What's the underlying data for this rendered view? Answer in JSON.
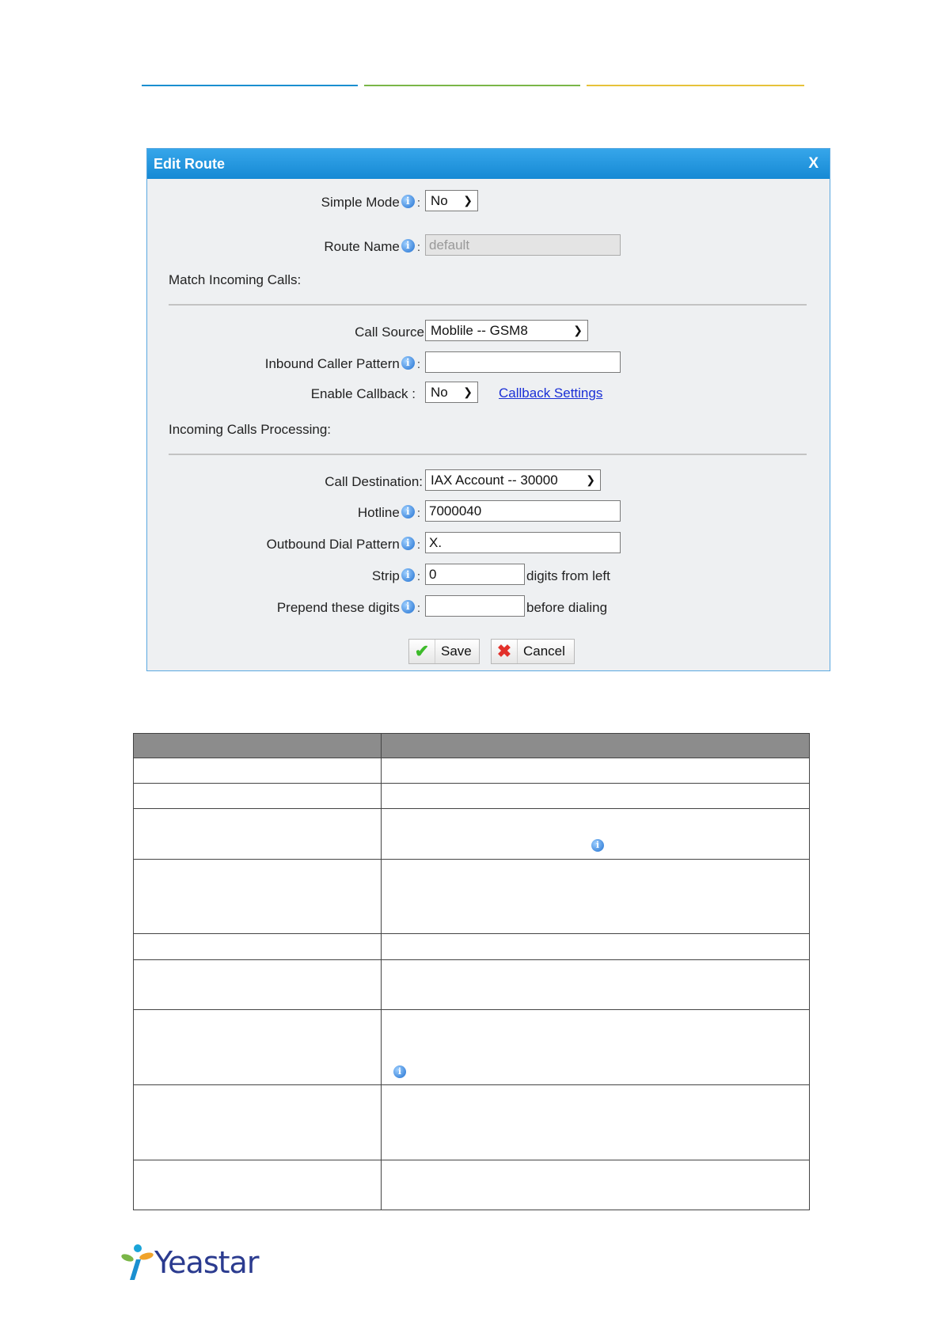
{
  "dialog": {
    "title": "Edit Route",
    "close_label": "X",
    "simple_mode": {
      "label": "Simple Mode",
      "value": "No"
    },
    "route_name": {
      "label": "Route Name",
      "value": "default"
    },
    "match_section": "Match Incoming Calls:",
    "call_source": {
      "label": "Call Source",
      "value": "Moblile -- GSM8"
    },
    "inbound_caller_pattern": {
      "label": "Inbound Caller Pattern",
      "value": ""
    },
    "enable_callback": {
      "label": "Enable Callback :",
      "value": "No",
      "link": "Callback Settings"
    },
    "processing_section": "Incoming Calls Processing:",
    "call_destination": {
      "label": "Call Destination:",
      "value": "IAX Account -- 30000"
    },
    "hotline": {
      "label": "Hotline",
      "value": "7000040"
    },
    "outbound_dial_pattern": {
      "label": "Outbound Dial Pattern",
      "value": "X."
    },
    "strip": {
      "label": "Strip",
      "value": "0",
      "suffix": "digits from left"
    },
    "prepend": {
      "label": "Prepend these digits",
      "value": "",
      "suffix": "before dialing"
    },
    "save_label": "Save",
    "cancel_label": "Cancel"
  },
  "logo": {
    "text": "Yeastar"
  }
}
